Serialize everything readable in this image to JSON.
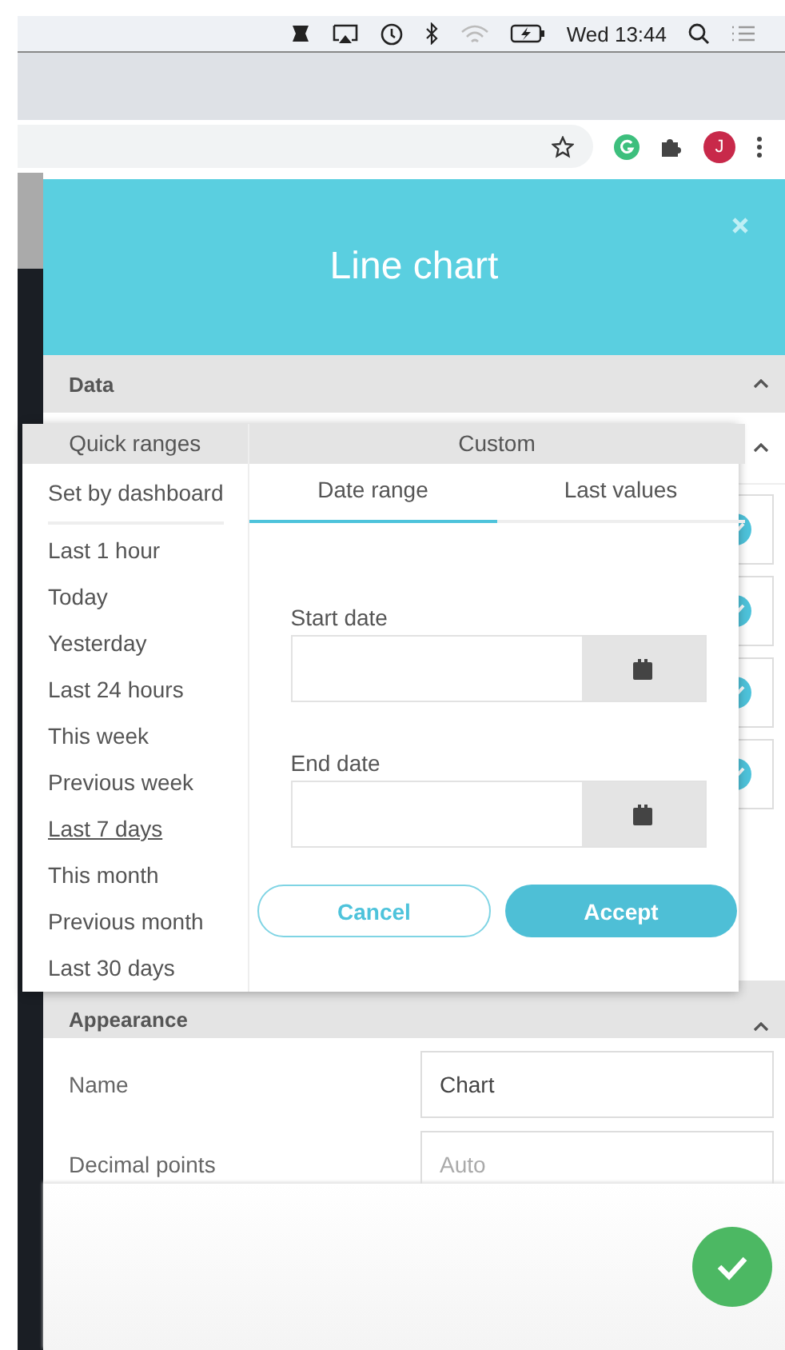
{
  "menu_bar": {
    "clock": "Wed 13:44"
  },
  "browser": {
    "avatar_initial": "J"
  },
  "dialog": {
    "title": "Line chart"
  },
  "data_section": {
    "title": "Data",
    "expanded": true
  },
  "hidden_section": {
    "expanded": true,
    "rows": [
      {
        "checked": true
      },
      {
        "checked": true
      },
      {
        "checked": true
      },
      {
        "checked": true
      }
    ]
  },
  "appearance_section": {
    "title": "Appearance",
    "expanded": true,
    "fields": [
      {
        "label": "Name",
        "value": "Chart"
      },
      {
        "label": "Decimal points",
        "placeholder": "Auto"
      }
    ]
  },
  "time_picker": {
    "quick_ranges": {
      "title": "Quick ranges",
      "dashboard_option": "Set by dashboard",
      "items": [
        {
          "label": "Last 1 hour",
          "selected": false
        },
        {
          "label": "Today",
          "selected": false
        },
        {
          "label": "Yesterday",
          "selected": false
        },
        {
          "label": "Last 24 hours",
          "selected": false
        },
        {
          "label": "This week",
          "selected": false
        },
        {
          "label": "Previous week",
          "selected": false
        },
        {
          "label": "Last 7 days",
          "selected": true
        },
        {
          "label": "This month",
          "selected": false
        },
        {
          "label": "Previous month",
          "selected": false
        },
        {
          "label": "Last 30 days",
          "selected": false
        }
      ]
    },
    "custom": {
      "title": "Custom",
      "tabs": [
        {
          "label": "Date range",
          "selected": true
        },
        {
          "label": "Last values",
          "selected": false
        }
      ],
      "start_label": "Start date",
      "end_label": "End date",
      "cancel": "Cancel",
      "accept": "Accept"
    }
  }
}
